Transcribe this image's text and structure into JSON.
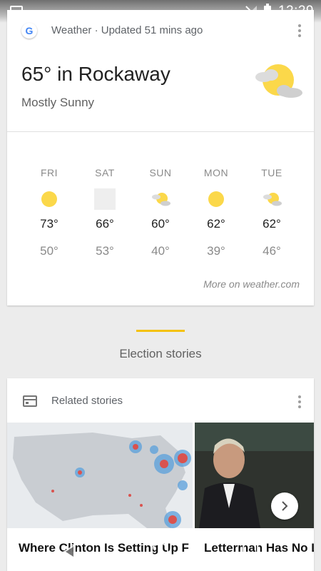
{
  "status_bar": {
    "time": "12:29"
  },
  "weather_card": {
    "header": "Weather · Updated 51 mins ago",
    "location_temp": "65° in Rockaway",
    "condition": "Mostly Sunny",
    "current_icon": "partly-cloudy-icon",
    "forecast": [
      {
        "day": "FRI",
        "icon": "sunny-icon",
        "high": "73°",
        "low": "50°"
      },
      {
        "day": "SAT",
        "icon": "unavailable-icon",
        "high": "66°",
        "low": "53°"
      },
      {
        "day": "SUN",
        "icon": "partly-cloudy-icon",
        "high": "60°",
        "low": "40°"
      },
      {
        "day": "MON",
        "icon": "sunny-icon",
        "high": "62°",
        "low": "39°"
      },
      {
        "day": "TUE",
        "icon": "partly-cloudy-icon",
        "high": "62°",
        "low": "46°"
      }
    ],
    "more_link": "More on weather.com"
  },
  "section": {
    "title": "Election stories",
    "accent_color": "#f4c20d"
  },
  "stories_card": {
    "header": "Related stories",
    "stories": [
      {
        "title": "Where Clinton Is Setting Up Field Offices — And Where T..."
      },
      {
        "title": "Letterman Has No Love for 'Damaged' Trump"
      }
    ]
  }
}
